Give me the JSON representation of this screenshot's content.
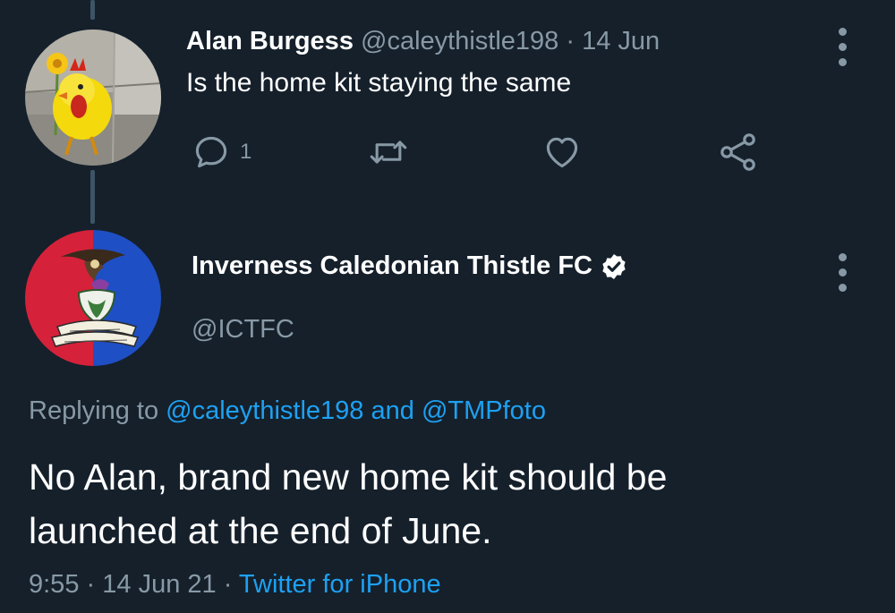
{
  "reply_tweet": {
    "author_name": "Alan Burgess",
    "handle": "@caleythistle198",
    "separator": "·",
    "date": "14 Jun",
    "text": "Is the home kit staying the same",
    "reply_count": "1",
    "actions": [
      "reply-icon",
      "retweet-icon",
      "like-icon",
      "share-icon"
    ]
  },
  "main_tweet": {
    "author_name": "Inverness Caledonian Thistle FC",
    "verified": true,
    "handle": "@ICTFC",
    "replying_prefix": "Replying to",
    "reply_mention_1": "@caleythistle198",
    "reply_and": "and",
    "reply_mention_2": "@TMPfoto",
    "text_line_1": "No Alan, brand new home kit should be",
    "text_line_2": "launched at the end of June.",
    "time": "9:55",
    "separator": "·",
    "date": "14 Jun 21",
    "source": "Twitter for iPhone"
  },
  "colors": {
    "background": "#15202b",
    "text": "#ffffff",
    "muted": "#8899a6",
    "link": "#1da1f2",
    "thread_line": "#3d5466",
    "badge_red": "#d6213a",
    "badge_blue": "#1f4fc4"
  }
}
